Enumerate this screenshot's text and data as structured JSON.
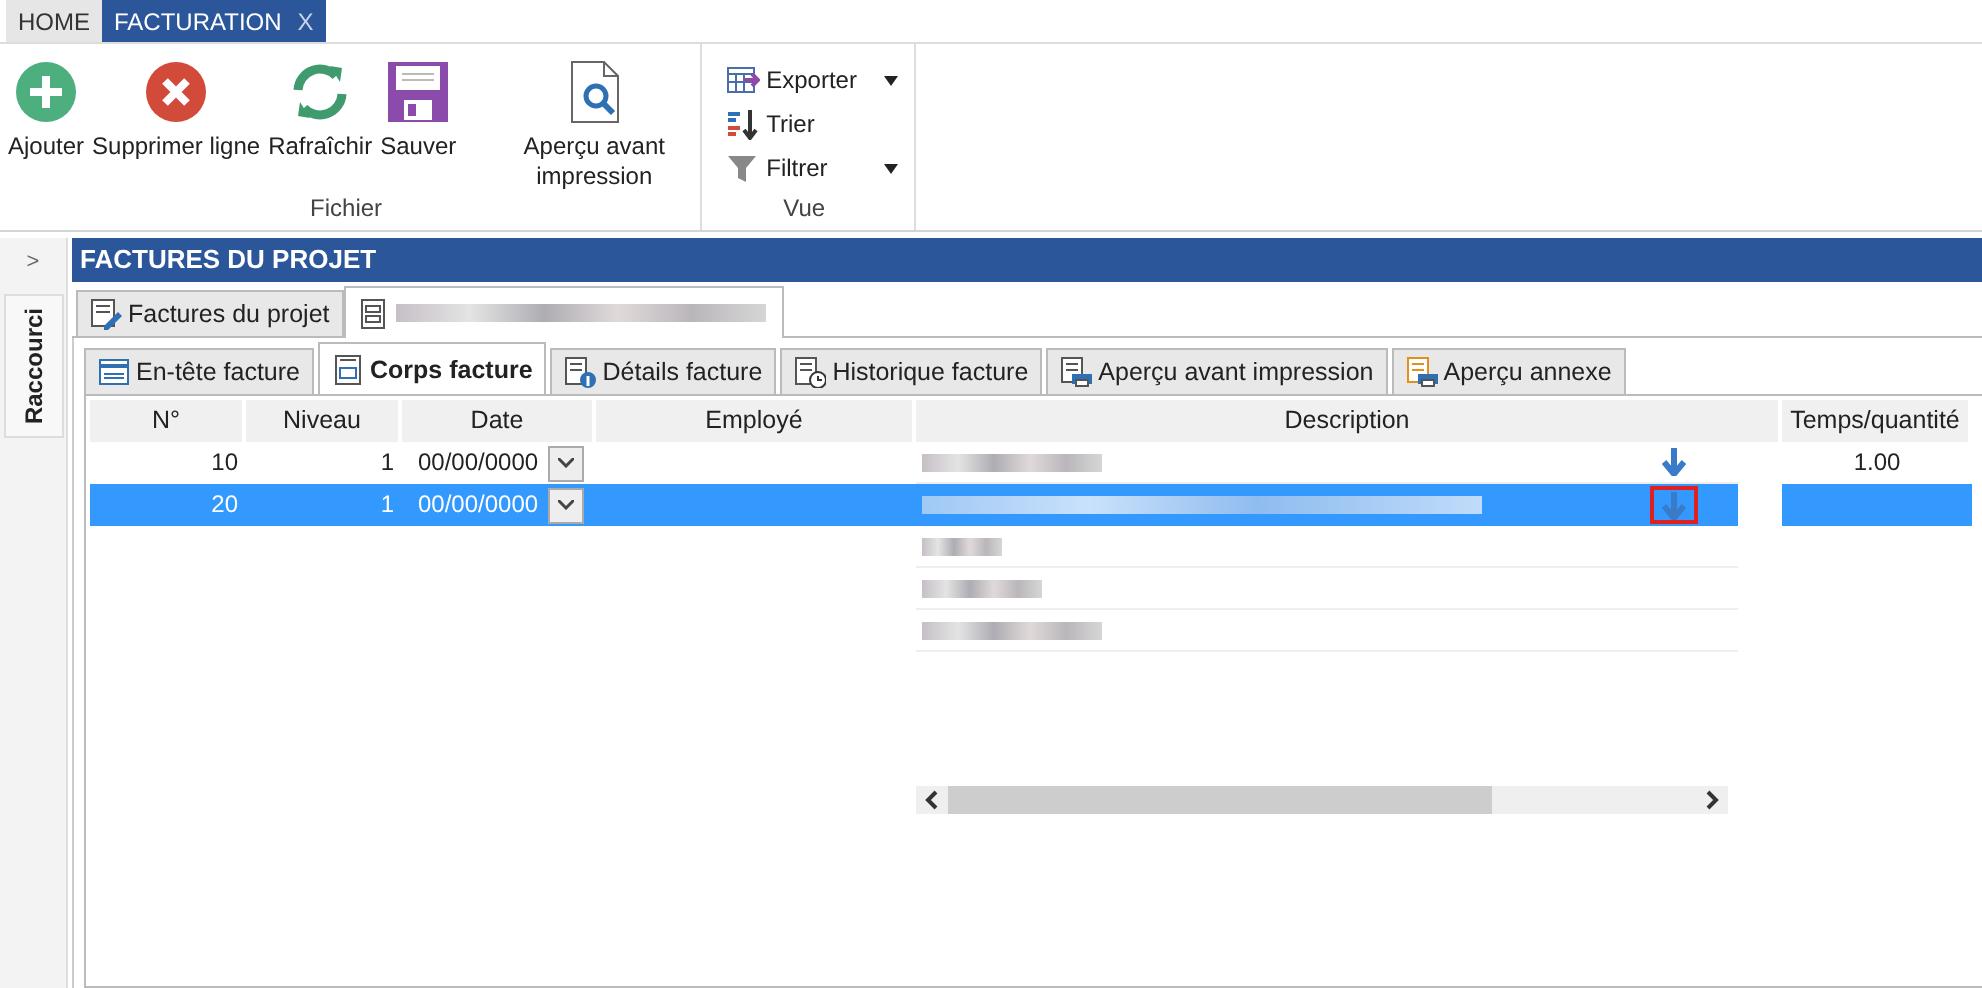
{
  "ribbon_tabs": [
    {
      "label": "HOME",
      "selected": false
    },
    {
      "label": "FACTURATION",
      "close": "X",
      "selected": true
    }
  ],
  "ribbon_groups": [
    {
      "label": "Fichier",
      "kind": "large",
      "buttons": [
        {
          "label": "Ajouter"
        },
        {
          "label": "Supprimer ligne"
        },
        {
          "label": "Rafraîchir"
        },
        {
          "label": "Sauver"
        },
        {
          "label": "Aperçu avant impression"
        }
      ]
    },
    {
      "label": "Vue",
      "kind": "small",
      "buttons": [
        {
          "label": "Exporter",
          "dropdown": true
        },
        {
          "label": "Trier",
          "dropdown": false
        },
        {
          "label": "Filtrer",
          "dropdown": true
        }
      ]
    }
  ],
  "sidebar": {
    "toggle": ">",
    "label": "Raccourci"
  },
  "panel_title": "FACTURES DU PROJET",
  "document_tabs": [
    {
      "label": "Factures du projet",
      "selected": false
    },
    {
      "redacted": true,
      "selected": true
    }
  ],
  "sub_tabs": [
    {
      "label": "En-tête facture",
      "selected": false
    },
    {
      "label": "Corps facture",
      "selected": true
    },
    {
      "label": "Détails facture",
      "selected": false
    },
    {
      "label": "Historique facture",
      "selected": false
    },
    {
      "label": "Aperçu avant impression",
      "selected": false
    },
    {
      "label": "Aperçu annexe",
      "selected": false
    }
  ],
  "table": {
    "columns": [
      "N°",
      "Niveau",
      "Date",
      "Employé",
      "Description",
      "Temps/quantité"
    ],
    "rows": [
      {
        "number": "10",
        "niveau": "1",
        "date": "00/00/0000",
        "quantity": "1.00",
        "selected": false,
        "action_highlighted": false,
        "description_lines": [
          {
            "redacted": true
          }
        ]
      },
      {
        "number": "20",
        "niveau": "1",
        "date": "00/00/0000",
        "selected": true,
        "action_highlighted": true,
        "description_lines": [
          {
            "redacted": true
          },
          {
            "redacted": true
          },
          {
            "redacted": true
          },
          {
            "redacted": true
          }
        ]
      }
    ]
  }
}
